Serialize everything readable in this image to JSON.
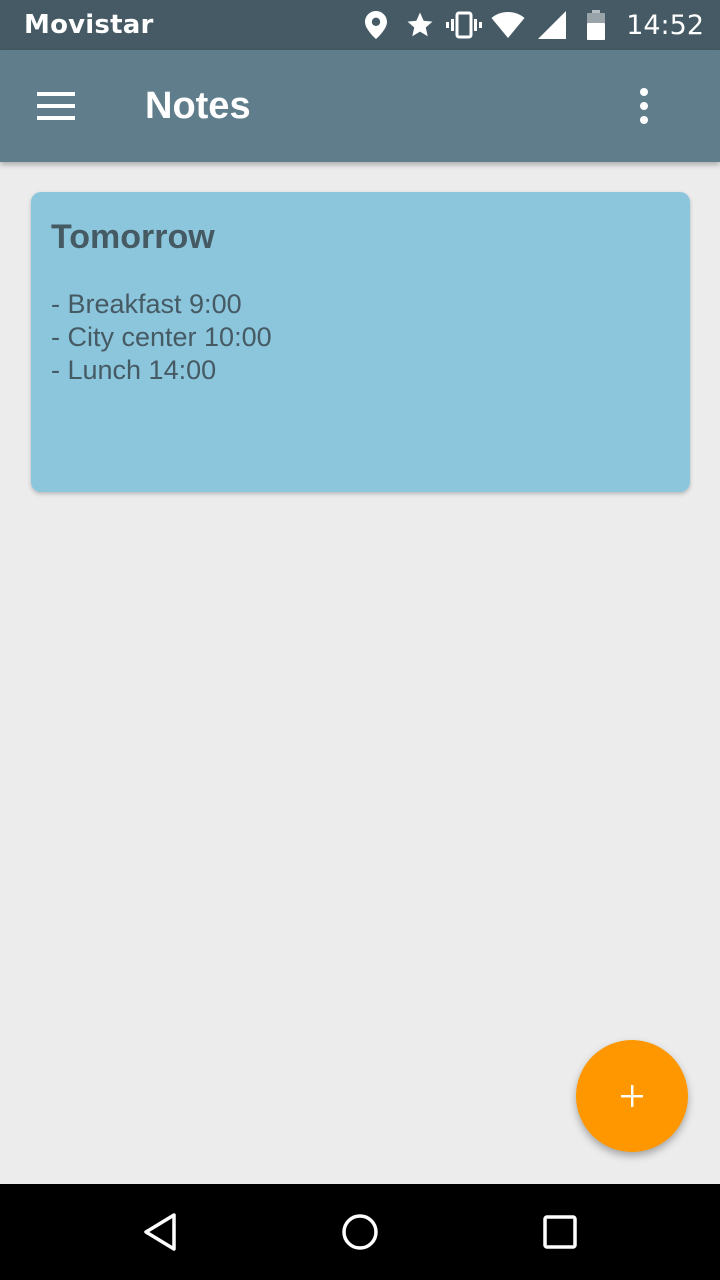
{
  "status_bar": {
    "carrier": "Movistar",
    "time": "14:52",
    "icons": [
      "location-icon",
      "star-icon",
      "vibrate-icon",
      "wifi-icon",
      "cell-signal-icon",
      "battery-icon"
    ]
  },
  "app_bar": {
    "title": "Notes",
    "menu_icon": "hamburger-menu-icon",
    "overflow_icon": "more-vertical-icon",
    "background_color": "#607d8b"
  },
  "notes": [
    {
      "title": "Tomorrow",
      "lines": [
        "- Breakfast 9:00",
        "- City center 10:00",
        "- Lunch 14:00"
      ],
      "color": "#8cc6dc"
    }
  ],
  "fab": {
    "icon": "plus-icon",
    "color": "#ff9800"
  },
  "nav_bar": {
    "buttons": [
      "back-icon",
      "home-icon",
      "recents-icon"
    ]
  }
}
